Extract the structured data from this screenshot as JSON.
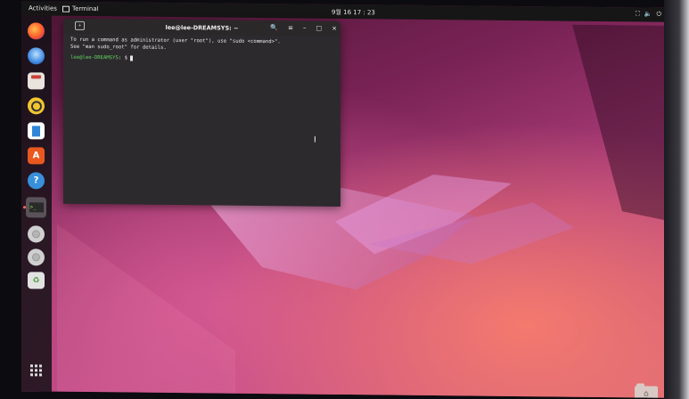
{
  "topbar": {
    "activities": "Activities",
    "app_name": "Terminal",
    "clock": "9월 16 17 : 23",
    "tray": {
      "network_icon": "network-icon",
      "volume_icon": "volume-icon",
      "power_icon": "power-icon"
    }
  },
  "dock": {
    "items": [
      {
        "name": "firefox-icon"
      },
      {
        "name": "thunderbird-icon"
      },
      {
        "name": "files-icon"
      },
      {
        "name": "rhythmbox-icon"
      },
      {
        "name": "libreoffice-writer-icon"
      },
      {
        "name": "app-center-icon",
        "glyph": "A"
      },
      {
        "name": "help-icon",
        "glyph": "?"
      },
      {
        "name": "terminal-icon",
        "glyph": ">_"
      },
      {
        "name": "disk-icon"
      },
      {
        "name": "disk-icon"
      },
      {
        "name": "trash-icon",
        "glyph": "♻"
      }
    ],
    "show_apps": "show-apps-grid-icon"
  },
  "terminal": {
    "title": "lee@lee-DREAMSYS: ~",
    "controls": {
      "search": "🔍",
      "menu": "≡",
      "minimize": "–",
      "maximize": "□",
      "close": "×"
    },
    "lines": [
      "To run a command as administrator (user \"root\"), use \"sudo <command>\".",
      "See \"man sudo_root\" for details."
    ],
    "prompt_user": "lee@lee-DREAMSYS",
    "prompt_path": ": $ "
  },
  "desktop": {
    "home_icon": "home-folder-icon"
  },
  "colors": {
    "ubuntu_purple": "#7a2356",
    "terminal_bg": "#2d2a2e",
    "prompt_green": "#5fd35f"
  }
}
